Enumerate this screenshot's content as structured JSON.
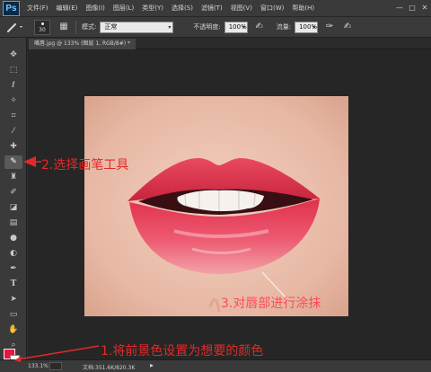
{
  "app": {
    "logo_text": "Ps",
    "menu": [
      "文件(F)",
      "编辑(E)",
      "图像(I)",
      "图层(L)",
      "类型(Y)",
      "选择(S)",
      "滤镜(T)",
      "视图(V)",
      "窗口(W)",
      "帮助(H)"
    ],
    "window_controls": [
      "—",
      "□",
      "✕"
    ]
  },
  "options": {
    "brush_size": "30",
    "mode_label": "模式:",
    "mode_value": "正常",
    "opacity_label": "不透明度:",
    "opacity_value": "100%",
    "flow_label": "流量:",
    "flow_value": "100%"
  },
  "document": {
    "tab_title": "嘴唇.jpg @ 133% (图层 1, RGB/8#) *"
  },
  "status": {
    "zoom": "133.1%",
    "doc_size": "文档:351.6K/820.3K"
  },
  "annotations": {
    "step1": "1.将前景色设置为想要的颜色",
    "step2": "2.选择画笔工具",
    "step3": "3.对唇部进行涂抹"
  },
  "colors": {
    "foreground": "#e5173f",
    "background": "#ffffff",
    "annotation": "#e12a2a"
  },
  "toolbar": {
    "tools": [
      "move-icon",
      "marquee-icon",
      "lasso-icon",
      "magic-wand-icon",
      "crop-icon",
      "eyedropper-icon",
      "healing-brush-icon",
      "brush-icon",
      "clone-stamp-icon",
      "history-brush-icon",
      "eraser-icon",
      "gradient-icon",
      "blur-icon",
      "dodge-icon",
      "pen-icon",
      "type-icon",
      "path-selection-icon",
      "shape-icon",
      "hand-icon",
      "zoom-icon"
    ],
    "active_tool": "brush-icon"
  }
}
